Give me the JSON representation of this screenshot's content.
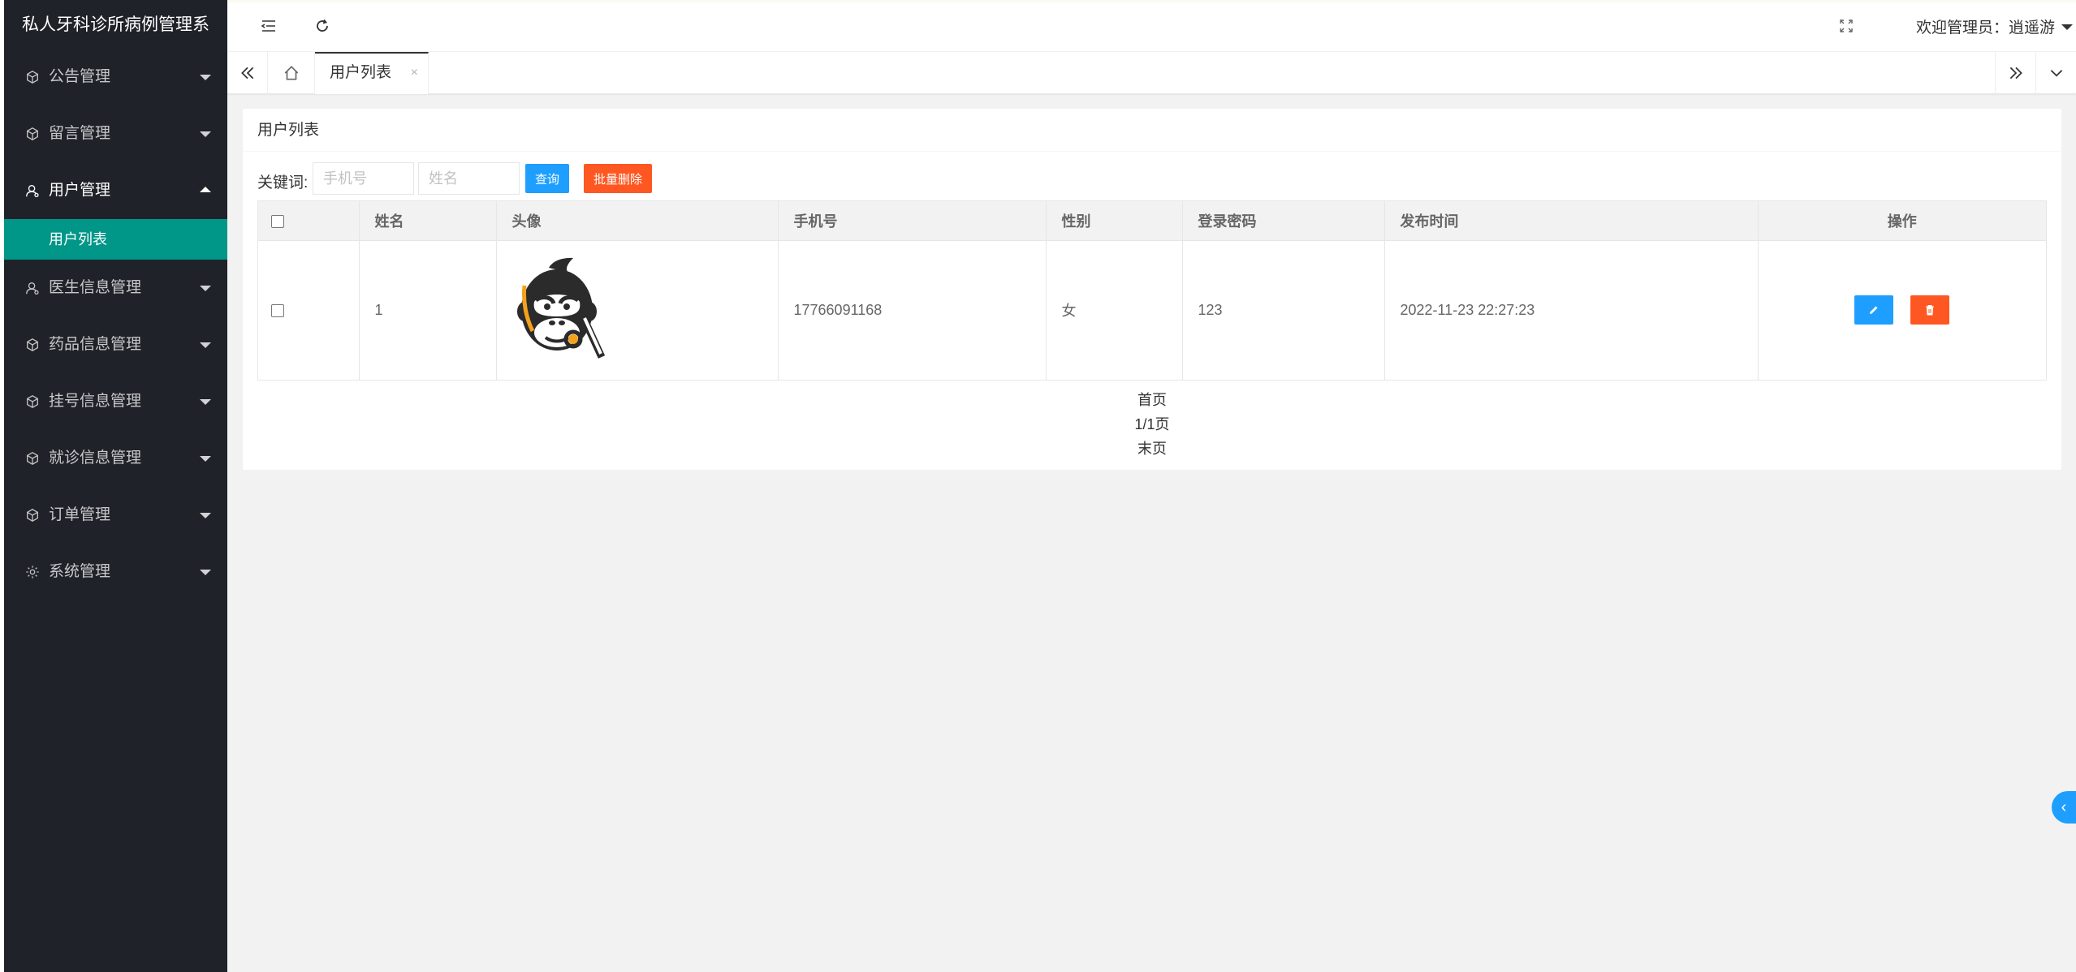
{
  "app": {
    "title": "私人牙科诊所病例管理系"
  },
  "sidebar": {
    "items": [
      {
        "label": "公告管理",
        "icon": "cube-icon",
        "open": false
      },
      {
        "label": "留言管理",
        "icon": "cube-icon",
        "open": false
      },
      {
        "label": "用户管理",
        "icon": "user-icon",
        "open": true,
        "children": [
          {
            "label": "用户列表",
            "active": true
          }
        ]
      },
      {
        "label": "医生信息管理",
        "icon": "user-icon",
        "open": false
      },
      {
        "label": "药品信息管理",
        "icon": "cube-icon",
        "open": false
      },
      {
        "label": "挂号信息管理",
        "icon": "cube-icon",
        "open": false
      },
      {
        "label": "就诊信息管理",
        "icon": "cube-icon",
        "open": false
      },
      {
        "label": "订单管理",
        "icon": "cube-icon",
        "open": false
      },
      {
        "label": "系统管理",
        "icon": "gear-icon",
        "open": false
      }
    ]
  },
  "header": {
    "welcome": "欢迎管理员：逍遥游"
  },
  "tabs": {
    "active_label": "用户列表",
    "close": "×"
  },
  "card": {
    "title": "用户列表"
  },
  "search": {
    "keyword_label": "关键词:",
    "phone_placeholder": "手机号",
    "name_placeholder": "姓名",
    "query_button": "查询",
    "batch_delete_button": "批量删除"
  },
  "table": {
    "headers": [
      "姓名",
      "头像",
      "手机号",
      "性别",
      "登录密码",
      "发布时间",
      "操作"
    ],
    "rows": [
      {
        "name": "1",
        "avatar": "gorilla-avatar",
        "phone": "17766091168",
        "gender": "女",
        "password": "123",
        "published": "2022-11-23 22:27:23"
      }
    ]
  },
  "pagination": {
    "first": "首页",
    "page_info": "1/1页",
    "last": "末页"
  },
  "colors": {
    "sidebar_bg": "#20222a",
    "active_item": "#009688",
    "primary": "#1e9fff",
    "danger": "#ff5722"
  }
}
